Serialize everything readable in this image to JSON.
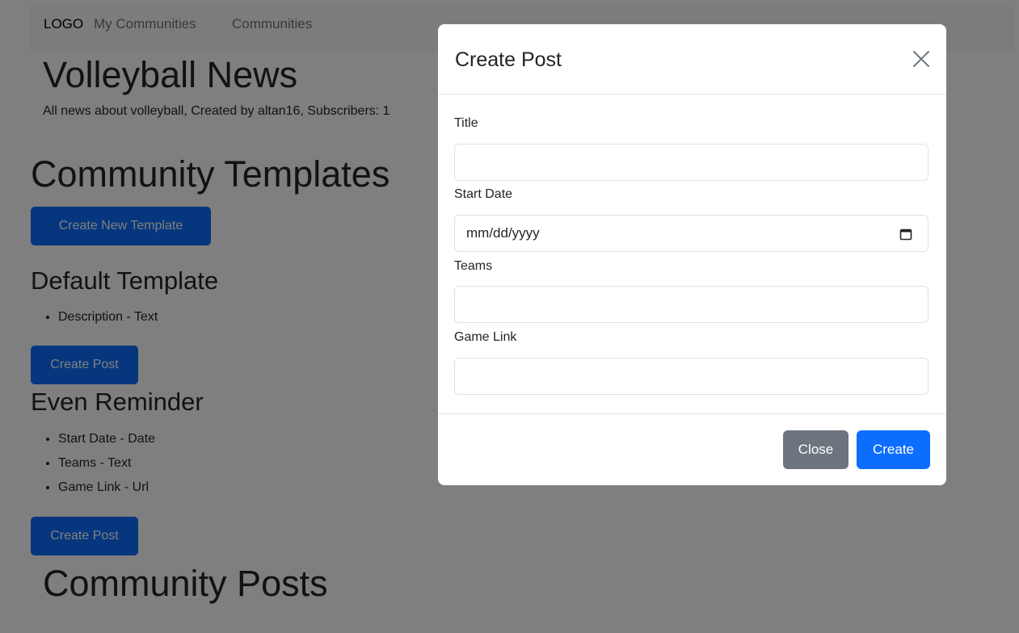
{
  "navbar": {
    "logo": "LOGO",
    "links": [
      "My Communities",
      "Communities"
    ]
  },
  "community": {
    "title": "Volleyball News",
    "description": "All news about volleyball, Created by altan16, Subscribers: 1"
  },
  "templates_section": {
    "heading": "Community Templates",
    "create_new_label": "Create New Template",
    "templates": [
      {
        "name": "Default Template",
        "fields": [
          "Description - Text"
        ],
        "create_post_label": "Create Post"
      },
      {
        "name": "Even Reminder",
        "fields": [
          "Start Date - Date",
          "Teams - Text",
          "Game Link - Url"
        ],
        "create_post_label": "Create Post"
      }
    ]
  },
  "posts_section": {
    "heading": "Community Posts"
  },
  "modal": {
    "title": "Create Post",
    "fields": [
      {
        "label": "Title",
        "value": "",
        "placeholder": ""
      },
      {
        "label": "Start Date",
        "value": "",
        "placeholder": "mm/dd/yyyy"
      },
      {
        "label": "Teams",
        "value": "",
        "placeholder": ""
      },
      {
        "label": "Game Link",
        "value": "",
        "placeholder": ""
      }
    ],
    "close_label": "Close",
    "create_label": "Create"
  },
  "colors": {
    "primary": "#0d6efd",
    "secondary": "#6c757d",
    "backdrop": "rgba(0,0,0,0.5)"
  },
  "icons": {
    "close": "close-icon",
    "calendar": "calendar-icon"
  }
}
